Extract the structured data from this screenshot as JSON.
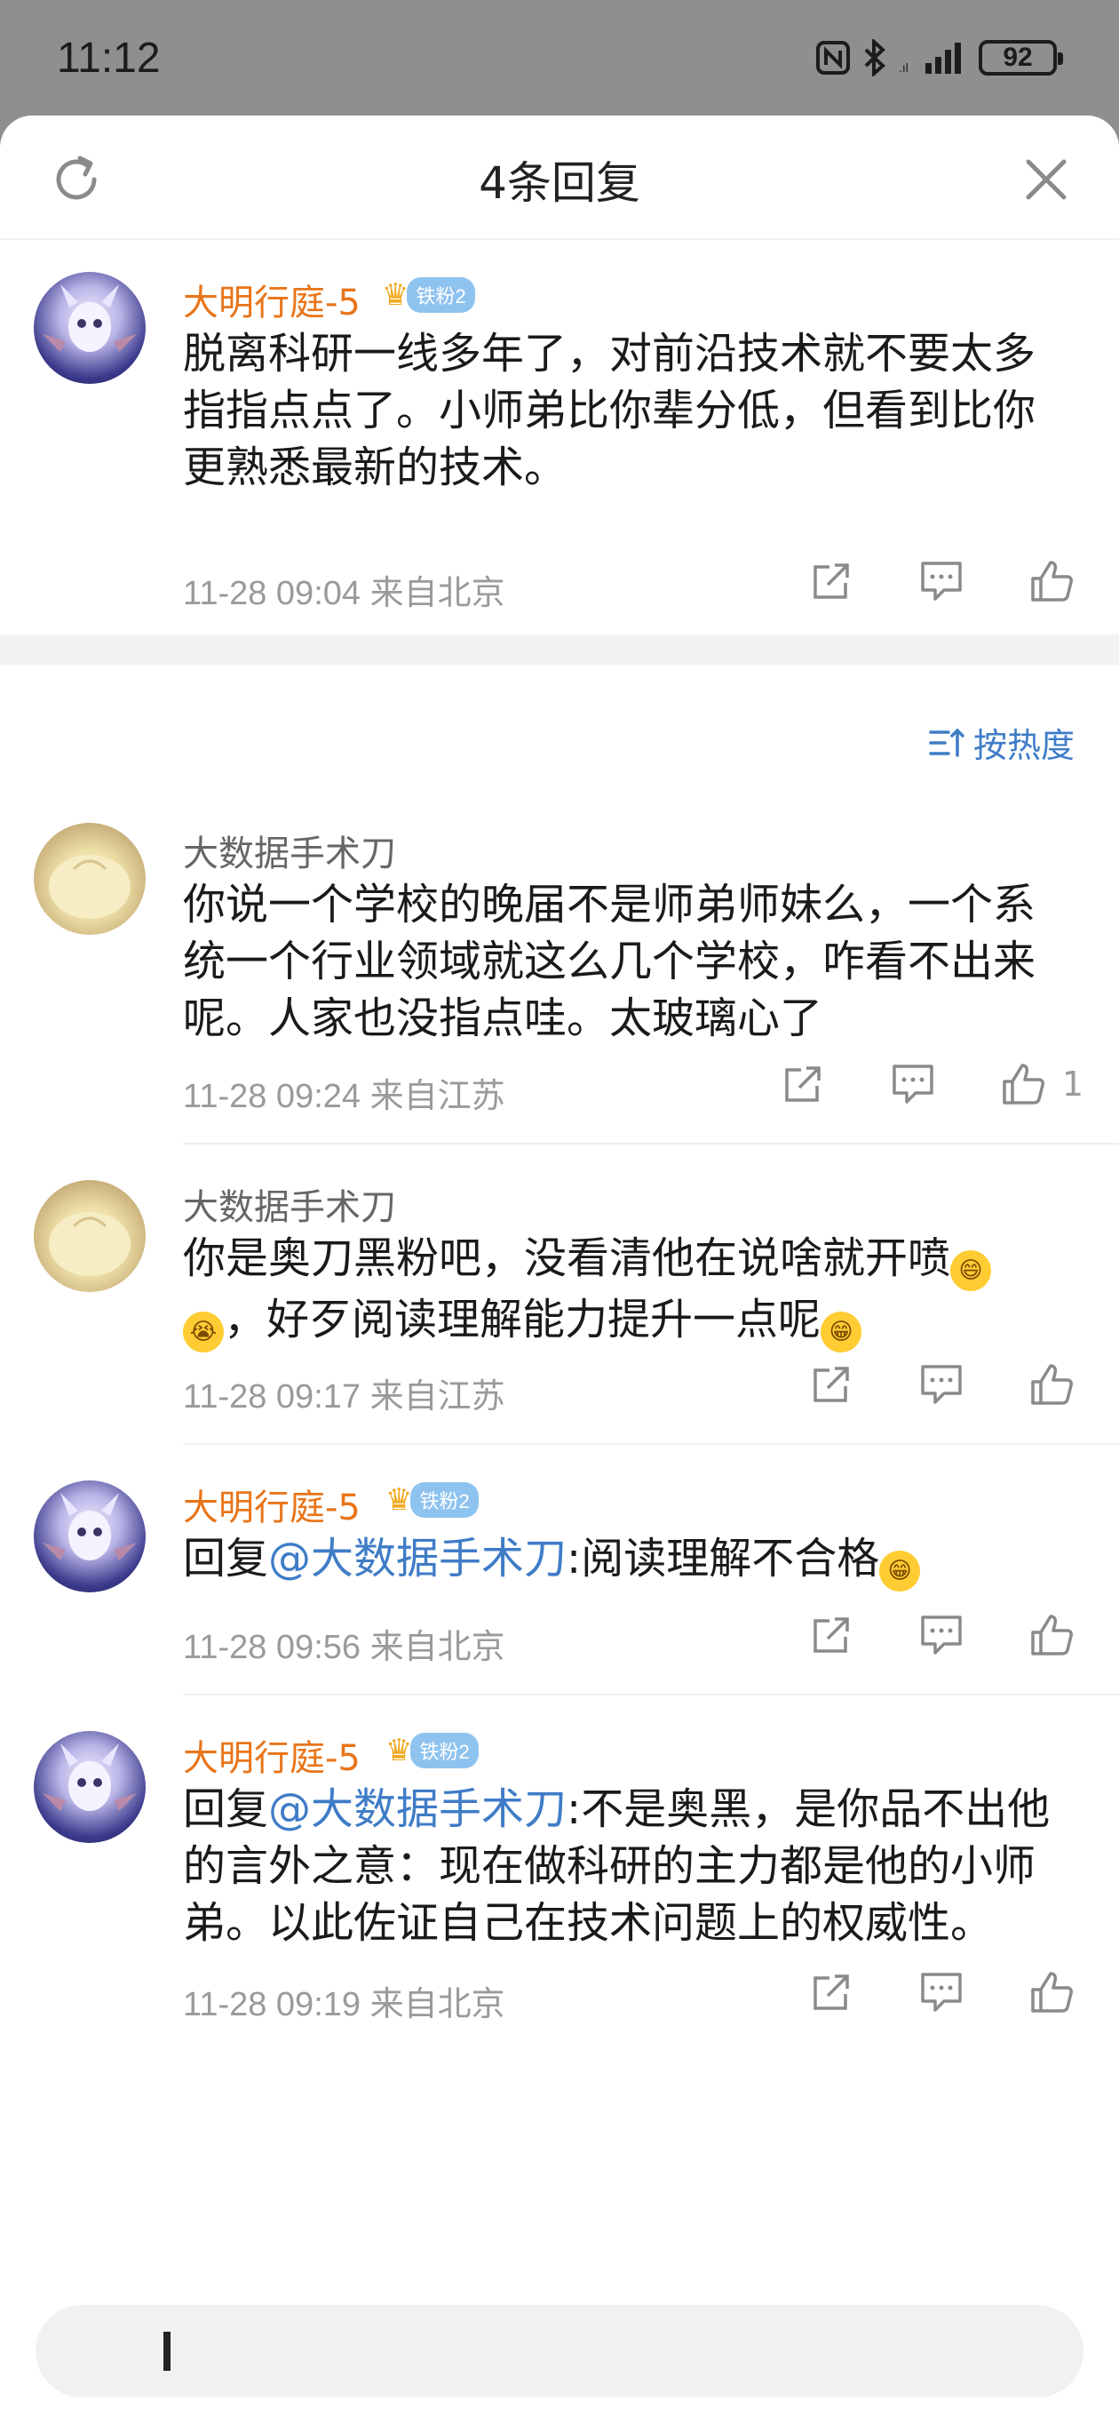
{
  "status": {
    "time": "11:12",
    "battery": "92"
  },
  "sheet": {
    "title": "4条回复"
  },
  "main_comment": {
    "user": "大明行庭-5",
    "fan_badge": "铁粉2",
    "text": "脱离科研一线多年了，对前沿技术就不要太多指指点点了。小师弟比你辈分低，但看到比你更熟悉最新的技术。",
    "time": "11-28 09:04",
    "location": "来自北京"
  },
  "sort_label": "按热度",
  "replies": [
    {
      "user": "大数据手术刀",
      "text": "你说一个学校的晚届不是师弟师妹么，一个系统一个行业领域就这么几个学校，咋看不出来呢。人家也没指点哇。太玻璃心了",
      "time": "11-28 09:24",
      "location": "来自江苏",
      "likes": "1"
    },
    {
      "user": "大数据手术刀",
      "text_a": "你是奥刀黑粉吧，没看清他在说啥就开喷",
      "text_b": "，好歹阅读理解能力提升一点呢",
      "time": "11-28 09:17",
      "location": "来自江苏"
    },
    {
      "user": "大明行庭-5",
      "fan_badge": "铁粉2",
      "reply_prefix": "回复",
      "mention": "@大数据手术刀",
      "text": ":阅读理解不合格",
      "time": "11-28 09:56",
      "location": "来自北京"
    },
    {
      "user": "大明行庭-5",
      "fan_badge": "铁粉2",
      "reply_prefix": "回复",
      "mention": "@大数据手术刀",
      "text": ":不是奥黑，是你品不出他的言外之意：现在做科研的主力都是他的小师弟。以此佐证自己在技术问题上的权威性。",
      "time": "11-28 09:19",
      "location": "来自北京"
    }
  ],
  "colors": {
    "accent": "#3f7cc7",
    "username_vip": "#e8751a",
    "meta": "#9a9a9a"
  }
}
